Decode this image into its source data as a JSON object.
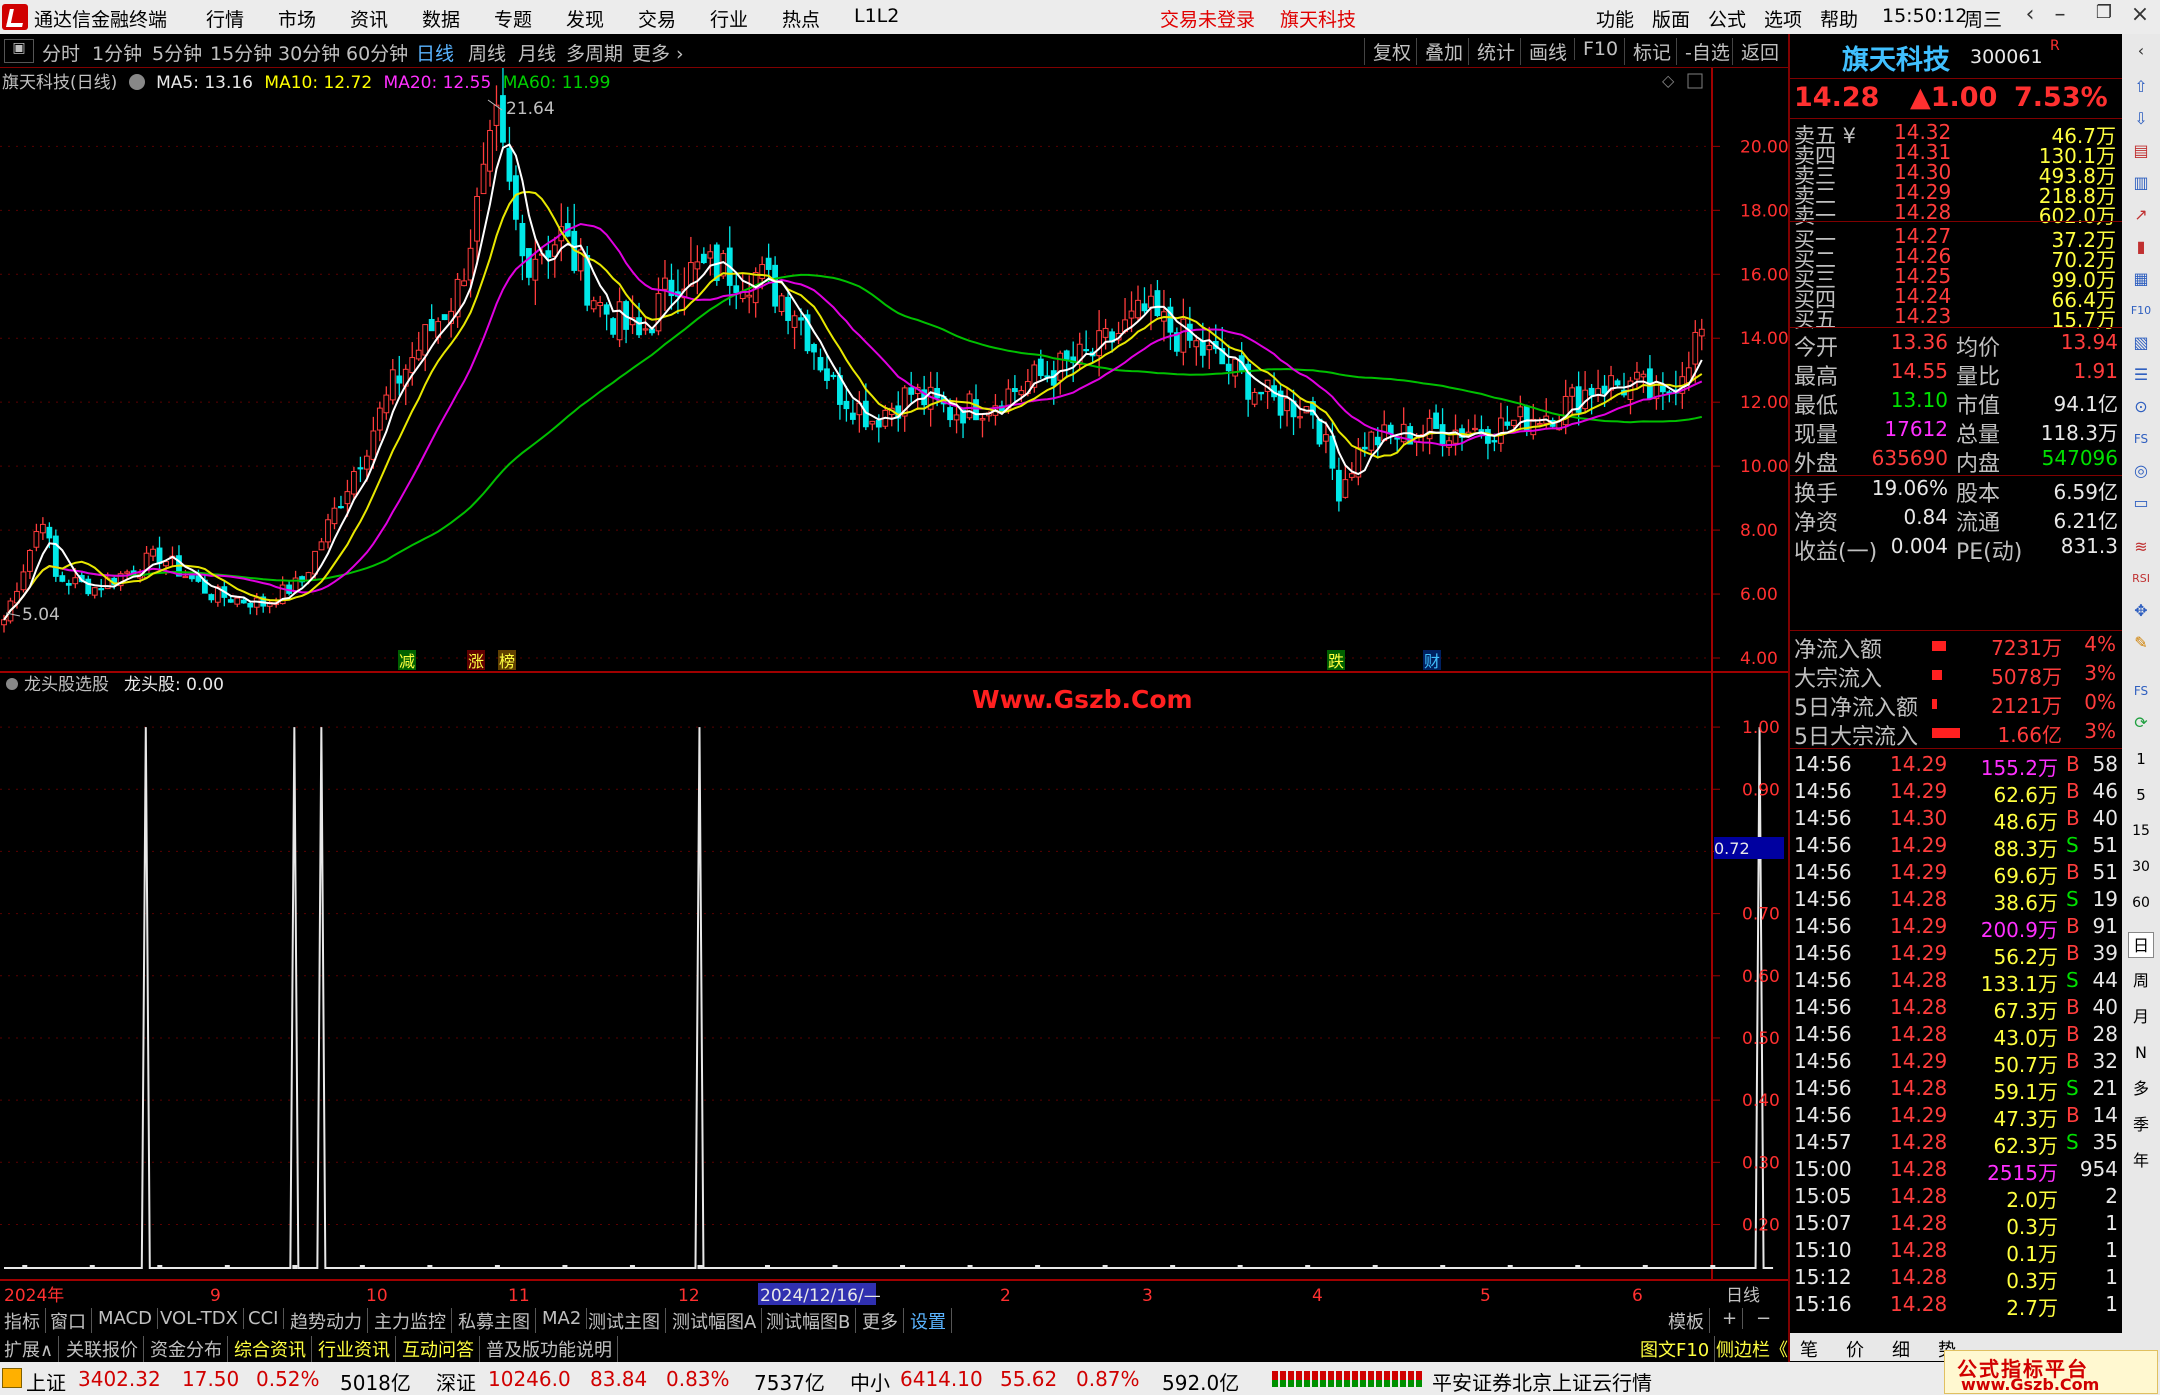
{
  "menubar": {
    "app_title": "通达信金融终端",
    "items": [
      "行情",
      "市场",
      "资讯",
      "数据",
      "专题",
      "发现",
      "交易",
      "行业",
      "热点",
      "L1L2"
    ],
    "status_login": "交易未登录",
    "status_stock": "旗天科技",
    "right_items": [
      "功能",
      "版面",
      "公式",
      "选项",
      "帮助"
    ],
    "time": "15:50:12",
    "weekday": "周三"
  },
  "periodbar": {
    "items": [
      "分时",
      "1分钟",
      "5分钟",
      "15分钟",
      "30分钟",
      "60分钟",
      "日线",
      "周线",
      "月线",
      "多周期",
      "更多 ›"
    ],
    "selected": "日线",
    "right_items": [
      "复权",
      "叠加",
      "统计",
      "画线",
      "F10",
      "标记",
      "-自选",
      "返回"
    ]
  },
  "chartinfo": {
    "stock": "旗天科技(日线)",
    "ma5": "MA5: 13.16",
    "ma10": "MA10: 12.72",
    "ma20": "MA20: 12.55",
    "ma60": "MA60: 11.99",
    "high_label": "21.64",
    "low_label": "5.04",
    "events": [
      "减",
      "涨",
      "榜",
      "跌",
      "财"
    ]
  },
  "indicator": {
    "name": "龙头股选股",
    "value": "龙头股: 0.00",
    "watermark": "Www.Gszb.Com",
    "current": "0.72"
  },
  "price_axis": [
    "20.00",
    "18.00",
    "16.00",
    "14.00",
    "12.00",
    "10.00",
    "8.00",
    "6.00",
    "4.00"
  ],
  "ind_axis": [
    "1.00",
    "0.90",
    "0.80",
    "0.70",
    "0.60",
    "0.50",
    "0.40",
    "0.30",
    "0.20"
  ],
  "time_axis": [
    "2024年",
    "9",
    "10",
    "11",
    "12",
    "2024/12/16/—",
    "2",
    "3",
    "4",
    "5",
    "6"
  ],
  "time_axis_right": "日线",
  "quote": {
    "name": "旗天科技",
    "code": "300061",
    "flag": "R",
    "price": "14.28",
    "change": "▲1.00",
    "pct": "7.53%",
    "asks": [
      {
        "label": "卖五 ¥",
        "price": "14.32",
        "vol": "46.7万"
      },
      {
        "label": "卖四",
        "price": "14.31",
        "vol": "130.1万"
      },
      {
        "label": "卖三",
        "price": "14.30",
        "vol": "493.8万"
      },
      {
        "label": "卖二",
        "price": "14.29",
        "vol": "218.8万"
      },
      {
        "label": "卖一",
        "price": "14.28",
        "vol": "602.0万"
      }
    ],
    "bids": [
      {
        "label": "买一",
        "price": "14.27",
        "vol": "37.2万"
      },
      {
        "label": "买二",
        "price": "14.26",
        "vol": "70.2万"
      },
      {
        "label": "买三",
        "price": "14.25",
        "vol": "99.0万"
      },
      {
        "label": "买四",
        "price": "14.24",
        "vol": "66.4万"
      },
      {
        "label": "买五",
        "price": "14.23",
        "vol": "15.7万"
      }
    ],
    "stats": [
      {
        "l1": "今开",
        "v1": "13.36",
        "c1": "up",
        "l2": "均价",
        "v2": "13.94",
        "c2": "up"
      },
      {
        "l1": "最高",
        "v1": "14.55",
        "c1": "up",
        "l2": "量比",
        "v2": "1.91",
        "c2": "up"
      },
      {
        "l1": "最低",
        "v1": "13.10",
        "c1": "dn",
        "l2": "市值",
        "v2": "94.1亿",
        "c2": "wht"
      },
      {
        "l1": "现量",
        "v1": "17612",
        "c1": "mag",
        "l2": "总量",
        "v2": "118.3万",
        "c2": "wht"
      },
      {
        "l1": "外盘",
        "v1": "635690",
        "c1": "up",
        "l2": "内盘",
        "v2": "547096",
        "c2": "dn"
      }
    ],
    "stats2": [
      {
        "l1": "换手",
        "v1": "19.06%",
        "l2": "股本",
        "v2": "6.59亿"
      },
      {
        "l1": "净资",
        "v1": "0.84",
        "l2": "流通",
        "v2": "6.21亿"
      },
      {
        "l1": "收益(一)",
        "v1": "0.004",
        "l2": "PE(动)",
        "v2": "831.3"
      }
    ],
    "flows": [
      {
        "label": "净流入额",
        "value": "7231万",
        "pct": "4%",
        "bar": 14
      },
      {
        "label": "大宗流入",
        "value": "5078万",
        "pct": "3%",
        "bar": 10
      },
      {
        "label": "5日净流入额",
        "value": "2121万",
        "pct": "0%",
        "bar": 5
      },
      {
        "label": "5日大宗流入",
        "value": "1.66亿",
        "pct": "3%",
        "bar": 28
      }
    ],
    "ticks": [
      [
        "14:56",
        "14.29",
        "155.2万",
        "B",
        "58"
      ],
      [
        "14:56",
        "14.29",
        "62.6万",
        "B",
        "46"
      ],
      [
        "14:56",
        "14.30",
        "48.6万",
        "B",
        "40"
      ],
      [
        "14:56",
        "14.29",
        "88.3万",
        "S",
        "51"
      ],
      [
        "14:56",
        "14.29",
        "69.6万",
        "B",
        "51"
      ],
      [
        "14:56",
        "14.28",
        "38.6万",
        "S",
        "19"
      ],
      [
        "14:56",
        "14.29",
        "200.9万",
        "B",
        "91"
      ],
      [
        "14:56",
        "14.29",
        "56.2万",
        "B",
        "39"
      ],
      [
        "14:56",
        "14.28",
        "133.1万",
        "S",
        "44"
      ],
      [
        "14:56",
        "14.28",
        "67.3万",
        "B",
        "40"
      ],
      [
        "14:56",
        "14.28",
        "43.0万",
        "B",
        "28"
      ],
      [
        "14:56",
        "14.29",
        "50.7万",
        "B",
        "32"
      ],
      [
        "14:56",
        "14.28",
        "59.1万",
        "S",
        "21"
      ],
      [
        "14:56",
        "14.29",
        "47.3万",
        "B",
        "14"
      ],
      [
        "14:57",
        "14.28",
        "62.3万",
        "S",
        "35"
      ],
      [
        "15:00",
        "14.28",
        "2515万",
        "",
        "954"
      ],
      [
        "15:05",
        "14.28",
        "2.0万",
        "",
        "2"
      ],
      [
        "15:07",
        "14.28",
        "0.3万",
        "",
        "1"
      ],
      [
        "15:10",
        "14.28",
        "0.1万",
        "",
        "1"
      ],
      [
        "15:12",
        "14.28",
        "0.3万",
        "",
        "1"
      ],
      [
        "15:16",
        "14.28",
        "2.7万",
        "",
        "1"
      ]
    ]
  },
  "bottombar1": [
    "指标",
    "窗口",
    "MACD",
    "VOL-TDX",
    "CCI",
    "趋势动力",
    "主力监控",
    "私募主图",
    "MA2",
    "测试主图",
    "测试幅图A",
    "测试幅图B",
    "更多",
    "设置"
  ],
  "bottombar1_right": [
    "模板",
    "+",
    "−"
  ],
  "bottombar2": [
    "扩展∧",
    "关联报价",
    "资金分布",
    "综合资讯",
    "行业资讯",
    "互动问答",
    "普及版功能说明"
  ],
  "bottombar2_right": [
    "图文F10",
    "侧边栏《",
    "笔",
    "价",
    "细",
    "势"
  ],
  "statusbar": {
    "items": [
      {
        "name": "上证",
        "val": "3402.32",
        "chg": "17.50",
        "pct": "0.52%",
        "amt": "5018亿"
      },
      {
        "name": "深证",
        "val": "10246.0",
        "chg": "83.84",
        "pct": "0.83%",
        "amt": "7537亿"
      },
      {
        "name": "中小",
        "val": "6414.10",
        "chg": "55.62",
        "pct": "0.87%",
        "amt": "592.0亿"
      }
    ],
    "server": "平安证券北京上证云行情",
    "site": "公式指标平台",
    "site_url": "www.Gszb.Com"
  },
  "colors": {
    "up": "#ff3c3c",
    "down": "#00e8e8",
    "ma5": "#ffffff",
    "ma10": "#ffff00",
    "ma20": "#ff00ff",
    "ma60": "#00c000",
    "border": "#800000"
  },
  "chart_data": {
    "type": "line",
    "ylim": [
      4,
      21.7
    ],
    "close_knots": [
      [
        0,
        5.2
      ],
      [
        6,
        8.5
      ],
      [
        8,
        6.5
      ],
      [
        14,
        6.2
      ],
      [
        24,
        7.2
      ],
      [
        32,
        6.0
      ],
      [
        40,
        5.7
      ],
      [
        46,
        6.4
      ],
      [
        52,
        9.0
      ],
      [
        60,
        12.5
      ],
      [
        70,
        15.5
      ],
      [
        76,
        20.5
      ],
      [
        80,
        16.5
      ],
      [
        86,
        17.2
      ],
      [
        92,
        15.0
      ],
      [
        98,
        14.0
      ],
      [
        104,
        16.0
      ],
      [
        110,
        16.2
      ],
      [
        116,
        16.0
      ],
      [
        122,
        15.0
      ],
      [
        128,
        12.5
      ],
      [
        134,
        11.5
      ],
      [
        140,
        12.3
      ],
      [
        146,
        11.7
      ],
      [
        152,
        12.0
      ],
      [
        160,
        12.8
      ],
      [
        168,
        13.5
      ],
      [
        176,
        14.8
      ],
      [
        182,
        14.0
      ],
      [
        188,
        13.2
      ],
      [
        196,
        12.0
      ],
      [
        202,
        11.8
      ],
      [
        206,
        9.3
      ],
      [
        210,
        10.8
      ],
      [
        220,
        11.1
      ],
      [
        230,
        11.2
      ],
      [
        240,
        11.8
      ],
      [
        246,
        12.6
      ],
      [
        252,
        12.5
      ],
      [
        256,
        12.0
      ],
      [
        262,
        14.28
      ]
    ],
    "ind_ylim": [
      0.13,
      1.05
    ],
    "ind_spikes": [
      21,
      43,
      47,
      103,
      260
    ]
  }
}
